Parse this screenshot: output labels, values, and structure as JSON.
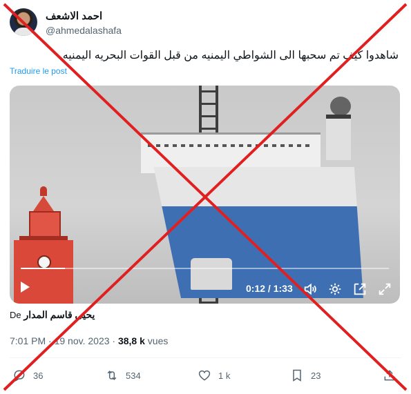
{
  "tweet": {
    "display_name": "احمد الاشعف",
    "handle": "@ahmedalashafa",
    "text": "شاهدوا كيف تم سحبها الى الشواطي اليمنيه من قبل القوات البحريه اليمنيه",
    "translate_label": "Traduire le post",
    "video": {
      "time_current": "0:12",
      "time_separator": " / ",
      "time_total": "1:33",
      "progress_fraction": 0.12
    },
    "credit_prefix": "De",
    "credit_author": "يحيى قاسم المدار",
    "time": "7:01 PM",
    "date": "19 nov. 2023",
    "views_count": "38,8 k",
    "views_label": "vues",
    "actions": {
      "replies": "36",
      "reposts": "534",
      "likes": "1 k",
      "bookmarks": "23"
    }
  },
  "icons": [
    "avatar",
    "play-icon",
    "volume-icon",
    "settings-icon",
    "pip-icon",
    "fullscreen-icon",
    "reply-icon",
    "repost-icon",
    "like-icon",
    "bookmark-icon",
    "share-icon"
  ],
  "colors": {
    "link": "#1d9bf0",
    "secondary_text": "#536471",
    "cross": "#e02020"
  }
}
